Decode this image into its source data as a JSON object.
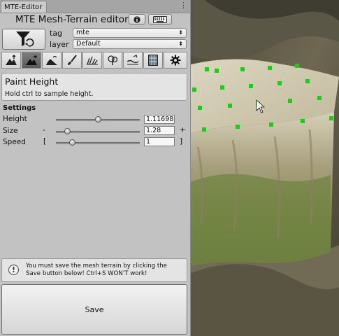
{
  "window": {
    "tab_label": "MTE-Editor",
    "menu_glyph": "⋮"
  },
  "header": {
    "title": "MTE Mesh-Terrain editor"
  },
  "filter": {
    "tag_label": "tag",
    "tag_value": "mte",
    "layer_label": "layer",
    "layer_value": "Default",
    "arrow": "⬍"
  },
  "tools": [
    {
      "name": "raise-lower-tool",
      "active": false
    },
    {
      "name": "paint-height-tool",
      "active": true
    },
    {
      "name": "smooth-height-tool",
      "active": false
    },
    {
      "name": "paint-texture-tool",
      "active": false
    },
    {
      "name": "place-tree-tool",
      "active": false
    },
    {
      "name": "place-detail-tool",
      "active": false
    },
    {
      "name": "flatten-tool",
      "active": false
    },
    {
      "name": "grid-tool",
      "active": false
    },
    {
      "name": "settings-tool",
      "active": false
    }
  ],
  "info": {
    "heading": "Paint Height",
    "description": "Hold ctrl to sample height."
  },
  "settings": {
    "heading": "Settings",
    "height": {
      "label": "Height",
      "value": "1.11698",
      "fraction": 0.5
    },
    "size": {
      "label": "Size",
      "value": "1.28",
      "fraction": 0.13,
      "minus": "-",
      "plus": "+"
    },
    "speed": {
      "label": "Speed",
      "value": "1",
      "fraction": 0.19,
      "left_bracket": "[",
      "right_bracket": "]"
    }
  },
  "warning": {
    "icon": "!",
    "text": "You must save the mesh terrain by clicking the Save button below! Ctrl+S WON'T work!"
  },
  "save": {
    "label": "Save"
  },
  "colors": {
    "panel": "#c2c2c2",
    "active_tool": "#6a6a6a",
    "marker": "#12d312"
  }
}
